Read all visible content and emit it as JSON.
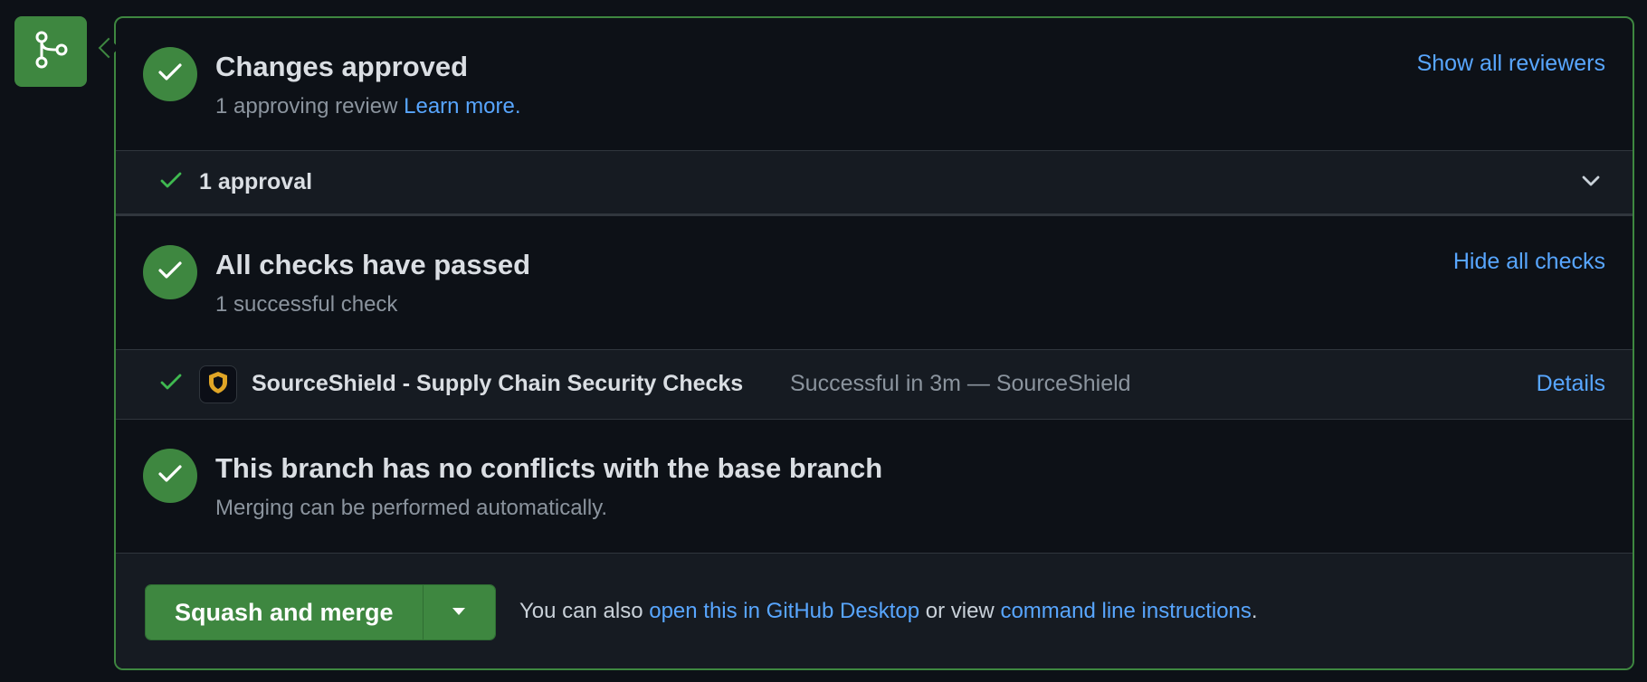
{
  "colors": {
    "success": "#3e8740",
    "link": "#58a6ff",
    "background": "#0d1117",
    "muted": "#8b949e"
  },
  "timeline_icon": "git-merge-icon",
  "review": {
    "title": "Changes approved",
    "subtitle": "1 approving review",
    "learn_more": "Learn more.",
    "show_all_reviewers": "Show all reviewers",
    "approval_summary": "1 approval"
  },
  "checks": {
    "title": "All checks have passed",
    "subtitle": "1 successful check",
    "hide_all_checks": "Hide all checks",
    "items": [
      {
        "name": "SourceShield - Supply Chain Security Checks",
        "status": "Successful in 3m — SourceShield",
        "details": "Details",
        "icon": "shield-icon"
      }
    ]
  },
  "conflicts": {
    "title": "This branch has no conflicts with the base branch",
    "subtitle": "Merging can be performed automatically."
  },
  "merge": {
    "button_label": "Squash and merge",
    "note_prefix": "You can also",
    "desktop_link": "open this in GitHub Desktop",
    "note_middle": "or view",
    "cli_link": "command line instructions",
    "note_suffix": "."
  }
}
